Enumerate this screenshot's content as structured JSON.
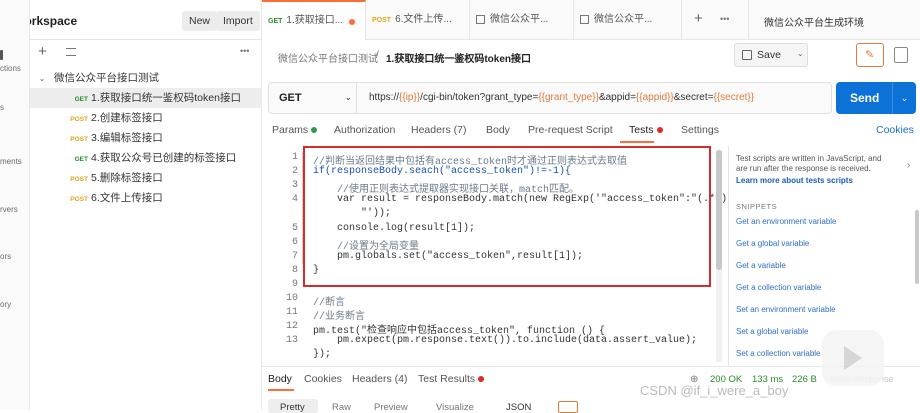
{
  "rail": {
    "items": [
      "ctions",
      "s",
      "ments",
      "rvers",
      "ors",
      "ory"
    ]
  },
  "workspace": {
    "title": "ly Workspace",
    "new_label": "New",
    "import_label": "Import",
    "add_icon": "+",
    "filter_icon": "filter-icon",
    "more_icon": "•••",
    "collection": "微信公众平台接口测试",
    "requests": [
      {
        "method": "GET",
        "name": "1.获取接口统一鉴权码token接口"
      },
      {
        "method": "POST",
        "name": "2.创建标签接口"
      },
      {
        "method": "POST",
        "name": "3.编辑标签接口"
      },
      {
        "method": "GET",
        "name": "4.获取公众号已创建的标签接口"
      },
      {
        "method": "POST",
        "name": "5.删除标签接口"
      },
      {
        "method": "POST",
        "name": "6.文件上传接口"
      }
    ]
  },
  "tabs": [
    {
      "method": "GET",
      "name": "1.获取接口..."
    },
    {
      "method": "POST",
      "name": "6.文件上传..."
    },
    {
      "method": "",
      "name": "微信公众平..."
    },
    {
      "method": "",
      "name": "微信公众平..."
    }
  ],
  "tabs_add": "+",
  "tabs_more": "•••",
  "environment": "微信公众平台生成环境",
  "breadcrumb": {
    "parent": "微信公众平台接口测试",
    "sep": "/",
    "current": "1.获取接口统一鉴权码token接口"
  },
  "save_label": "Save",
  "request": {
    "method": "GET",
    "url_parts": [
      {
        "t": "https://",
        "v": false
      },
      {
        "t": "{{ip}}",
        "v": true
      },
      {
        "t": "/cgi-bin/token?grant_type=",
        "v": false
      },
      {
        "t": "{{grant_type}}",
        "v": true
      },
      {
        "t": "&appid=",
        "v": false
      },
      {
        "t": "{{appid}}",
        "v": true
      },
      {
        "t": "&secret=",
        "v": false
      },
      {
        "t": "{{secret}}",
        "v": true
      }
    ]
  },
  "send_label": "Send",
  "request_tabs": [
    "Params",
    "Authorization",
    "Headers (7)",
    "Body",
    "Pre-request Script",
    "Tests",
    "Settings"
  ],
  "cookies_label": "Cookies",
  "code_lines": [
    {
      "n": "1",
      "t": "//判断当返回结果中包括有access_token时才通过正则表达式去取值",
      "c": "cm"
    },
    {
      "n": "2",
      "t": "if(responseBody.seach(\"access_token\")!=-1){",
      "c": "kw"
    },
    {
      "n": "3",
      "t": "    //使用正则表达式提取器实现接口关联，match匹配。",
      "c": "cm"
    },
    {
      "n": "4",
      "t": "    var result = responseBody.match(new RegExp('\"access_token\":\"(.*?)",
      "c": ""
    },
    {
      "n": "",
      "t": "        \"'));",
      "c": ""
    },
    {
      "n": "5",
      "t": "    console.log(result[1]);",
      "c": ""
    },
    {
      "n": "6",
      "t": "    //设置为全局变量",
      "c": "cm"
    },
    {
      "n": "7",
      "t": "    pm.globals.set(\"access_token\",result[1]);",
      "c": ""
    },
    {
      "n": "8",
      "t": "}",
      "c": ""
    },
    {
      "n": "9",
      "t": "",
      "c": ""
    },
    {
      "n": "10",
      "t": "//断言",
      "c": "cm"
    },
    {
      "n": "11",
      "t": "//业务断言",
      "c": "cm"
    },
    {
      "n": "12",
      "t": "pm.test(\"检查响应中包括access_token\", function () {",
      "c": ""
    },
    {
      "n": "13",
      "t": "    pm.expect(pm.response.text()).to.include(data.assert_value);",
      "c": ""
    },
    {
      "n": "",
      "t": "});",
      "c": ""
    }
  ],
  "snippets": {
    "intro": [
      "Test scripts are written in JavaScript, and",
      "are run after the response is received."
    ],
    "learn": "Learn more about tests scripts",
    "title": "SNIPPETS",
    "items": [
      "Get an environment variable",
      "Get a global variable",
      "Get a variable",
      "Get a collection variable",
      "Set an environment variable",
      "Set a global variable",
      "Set a collection variable"
    ]
  },
  "response_tabs": [
    "Body",
    "Cookies",
    "Headers (4)",
    "Test Results"
  ],
  "response_status": {
    "code": "200 OK",
    "time": "133 ms",
    "size": "226 B",
    "save": "Save Response"
  },
  "response_sub": [
    "Pretty",
    "Raw",
    "Preview",
    "Visualize",
    "JSON"
  ],
  "watermark": "CSDN @if_i_were_a_boy",
  "colors": {
    "accent": "#ff6c37",
    "send": "#0c72d8",
    "get": "#2a8a2a",
    "post": "#e0a419",
    "annotation": "#d62b2b"
  }
}
